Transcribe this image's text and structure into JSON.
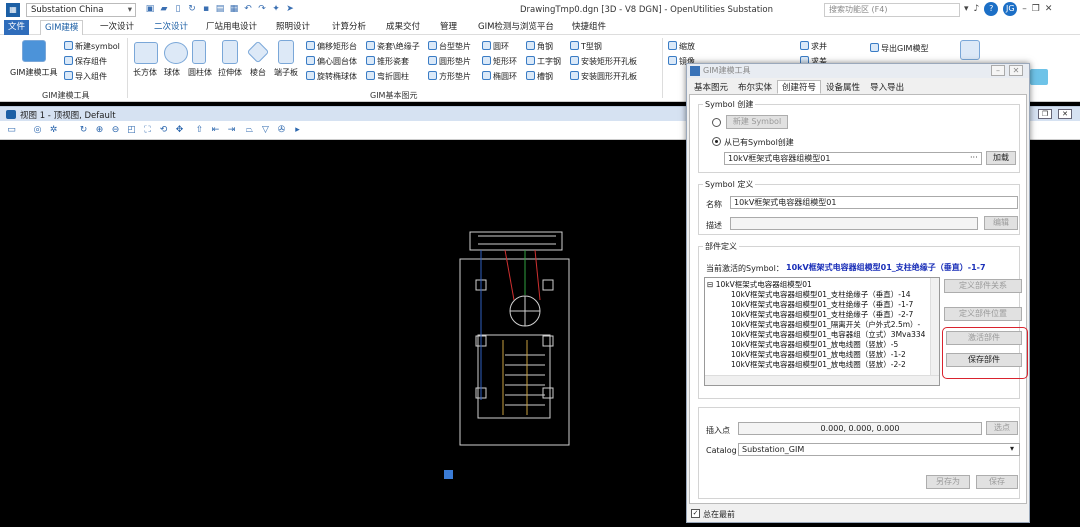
{
  "titlebar": {
    "workspace": "Substation China",
    "window_title": "DrawingTmp0.dgn [3D - V8 DGN] - OpenUtilities Substation",
    "search_placeholder": "搜索功能区 (F4)",
    "user_initials": "JG",
    "help": "?"
  },
  "tabs": [
    "文件",
    "GIM建模",
    "一次设计",
    "二次设计",
    "厂站用电设计",
    "照明设计",
    "计算分析",
    "成果交付",
    "管理",
    "GIM检测与浏览平台",
    "快捷组件"
  ],
  "ribbon": {
    "group1_label": "GIM建模工具",
    "gim_tool": "GIM建模工具",
    "new_symbol": "新建symbol",
    "save_component": "保存组件",
    "import_component": "导入组件",
    "shapes": [
      "长方体",
      "球体",
      "圆柱体",
      "拉伸体",
      "棱台",
      "端子板"
    ],
    "col1": [
      "偏移矩形台",
      "偏心圆台体",
      "旋转椭球体"
    ],
    "col2": [
      "瓷套\\绝缘子",
      "锥形瓷套",
      "弯折圆柱"
    ],
    "col3": [
      "台型垫片",
      "圆形垫片",
      "方形垫片"
    ],
    "col4": [
      "圆环",
      "矩形环",
      "椭圆环"
    ],
    "col5": [
      "角钢",
      "工字钢",
      "槽钢"
    ],
    "col6": [
      "T型钢",
      "安装矩形开孔板",
      "安装圆形开孔板"
    ],
    "group2_label": "GIM基本图元",
    "right1": [
      "缩放",
      "镜像"
    ],
    "right2": [
      "求并",
      "求差"
    ],
    "export": "导出GIM模型"
  },
  "view": {
    "title": "视图 1 - 顶视图, Default"
  },
  "dialog": {
    "title": "GIM建模工具",
    "tabs": [
      "基本图元",
      "布尔实体",
      "创建符号",
      "设备属性",
      "导入导出"
    ],
    "symbol_create": {
      "legend": "Symbol 创建",
      "new_btn": "新建 Symbol",
      "from_existing": "从已有Symbol创建",
      "existing_value": "10kV框架式电容器组模型01",
      "load_btn": "加载"
    },
    "symbol_def": {
      "legend": "Symbol 定义",
      "name_label": "名称",
      "name_value": "10kV框架式电容器组模型01",
      "desc_label": "描述",
      "edit_btn": "编辑"
    },
    "part_def": {
      "legend": "部件定义",
      "active_label": "当前激活的Symbol：",
      "active_value": "10kV框架式电容器组模型01_支柱绝缘子（垂直）-1-7",
      "tree_root": "10kV框架式电容器组模型01",
      "tree_items": [
        "10kV框架式电容器组模型01_支柱绝缘子（垂直）-14",
        "10kV框架式电容器组模型01_支柱绝缘子（垂直）-1-7",
        "10kV框架式电容器组模型01_支柱绝缘子（垂直）-2-7",
        "10kV框架式电容器组模型01_隔离开关（户外式2.5m）-",
        "10kV框架式电容器组模型01_电容器组（立式）3Mva334",
        "10kV框架式电容器组模型01_放电线圈（竖放）-5",
        "10kV框架式电容器组模型01_放电线圈（竖放）-1-2",
        "10kV框架式电容器组模型01_放电线圈（竖放）-2-2"
      ],
      "btn_relation": "定义部件关系",
      "btn_position": "定义部件位置",
      "btn_activate": "激活部件",
      "btn_save": "保存部件"
    },
    "insert_label": "插入点",
    "insert_value": "0.000, 0.000, 0.000",
    "pick_btn": "选点",
    "catalog_label": "Catalog",
    "catalog_value": "Substation_GIM",
    "save_as": "另存为",
    "save": "保存",
    "topmost": "总在最前"
  }
}
